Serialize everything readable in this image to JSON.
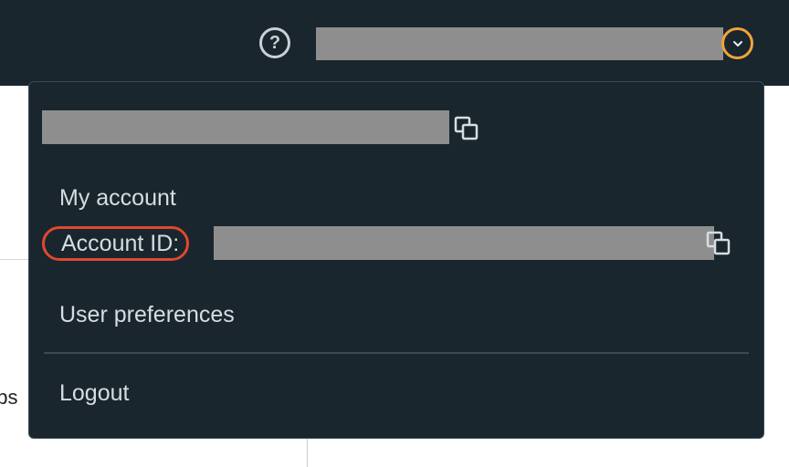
{
  "topbar": {
    "help_icon_glyph": "?",
    "icons": [
      "question-circle-icon",
      "chevron-down-icon"
    ],
    "accent_color": "#f2a33a"
  },
  "background": {
    "partial_text": "obs"
  },
  "menu": {
    "items": [
      {
        "label": "My account"
      },
      {
        "label": "Account ID:"
      },
      {
        "label": "User preferences"
      },
      {
        "label": "Logout"
      }
    ],
    "highlight_color": "#e1482f",
    "copy_icon": "copy-icon"
  }
}
